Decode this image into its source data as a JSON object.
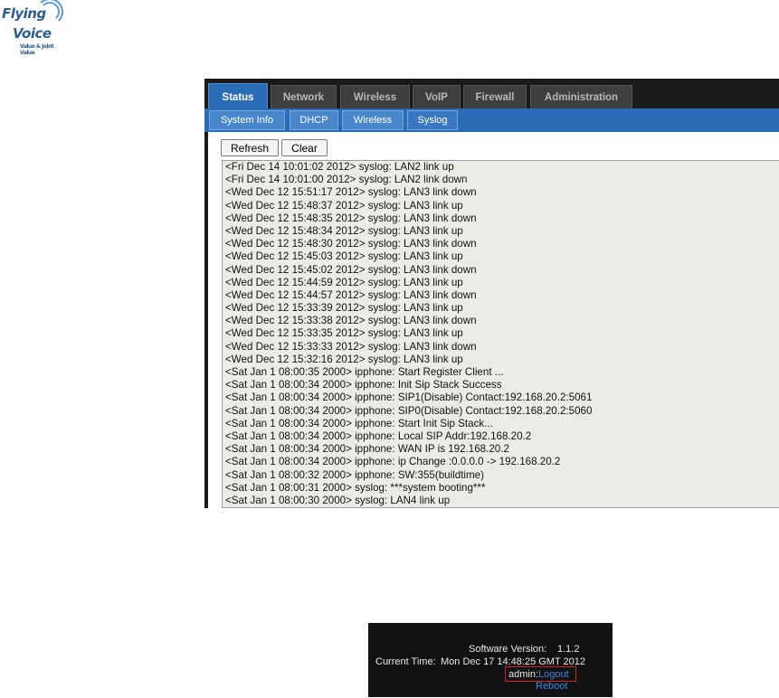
{
  "logo": {
    "line1": "Flying",
    "line2": "Voice",
    "line3": "Value & Joint Value"
  },
  "tabs": [
    {
      "label": "Status",
      "active": true
    },
    {
      "label": "Network",
      "active": false
    },
    {
      "label": "Wireless",
      "active": false
    },
    {
      "label": "VoIP",
      "active": false
    },
    {
      "label": "Firewall",
      "active": false
    },
    {
      "label": "Administration",
      "active": false
    }
  ],
  "subtabs": [
    {
      "label": "System Info",
      "active": false
    },
    {
      "label": "DHCP",
      "active": false
    },
    {
      "label": "Wireless",
      "active": false
    },
    {
      "label": "Syslog",
      "active": true
    }
  ],
  "buttons": {
    "refresh": "Refresh",
    "clear": "Clear"
  },
  "log": [
    "<Fri Dec 14 10:01:02 2012> syslog: LAN2 link up",
    "<Fri Dec 14 10:01:00 2012> syslog: LAN2 link down",
    "<Wed Dec 12 15:51:17 2012> syslog: LAN3 link down",
    "<Wed Dec 12 15:48:37 2012> syslog: LAN3 link up",
    "<Wed Dec 12 15:48:35 2012> syslog: LAN3 link down",
    "<Wed Dec 12 15:48:34 2012> syslog: LAN3 link up",
    "<Wed Dec 12 15:48:30 2012> syslog: LAN3 link down",
    "<Wed Dec 12 15:45:03 2012> syslog: LAN3 link up",
    "<Wed Dec 12 15:45:02 2012> syslog: LAN3 link down",
    "<Wed Dec 12 15:44:59 2012> syslog: LAN3 link up",
    "<Wed Dec 12 15:44:57 2012> syslog: LAN3 link down",
    "<Wed Dec 12 15:33:39 2012> syslog: LAN3 link up",
    "<Wed Dec 12 15:33:38 2012> syslog: LAN3 link down",
    "<Wed Dec 12 15:33:35 2012> syslog: LAN3 link up",
    "<Wed Dec 12 15:33:33 2012> syslog: LAN3 link down",
    "<Wed Dec 12 15:32:16 2012> syslog: LAN3 link up",
    "<Sat Jan  1 08:00:35 2000> ipphone: Start Register Client ...",
    "<Sat Jan  1 08:00:34 2000> ipphone: Init Sip Stack Success",
    "<Sat Jan  1 08:00:34 2000> ipphone: SIP1(Disable) Contact:192.168.20.2:5061",
    "<Sat Jan  1 08:00:34 2000> ipphone: SIP0(Disable) Contact:192.168.20.2:5060",
    "<Sat Jan  1 08:00:34 2000> ipphone: Start Init Sip Stack...",
    "<Sat Jan  1 08:00:34 2000> ipphone: Local SIP Addr:192.168.20.2",
    "<Sat Jan  1 08:00:34 2000> ipphone: WAN IP is 192.168.20.2",
    "<Sat Jan  1 08:00:34 2000> ipphone: ip Change :0.0.0.0 -> 192.168.20.2",
    "<Sat Jan  1 08:00:32 2000> ipphone: SW:355(buildtime)",
    "<Sat Jan  1 08:00:31 2000> syslog: ***system booting***",
    "<Sat Jan  1 08:00:30 2000> syslog: LAN4 link up"
  ],
  "footer": {
    "version_label": "Software Version:",
    "version": "1.1.2",
    "time_label": "Current Time:",
    "time": "Mon Dec 17 14:48:25 GMT 2012",
    "user": "admin:",
    "logout": "Logout",
    "reboot": "Reboot"
  },
  "colors": {
    "accent": "#2a6db6",
    "tab_bg": "#3f3f3f",
    "link": "#3a86e6",
    "highlight": "#d42222"
  }
}
